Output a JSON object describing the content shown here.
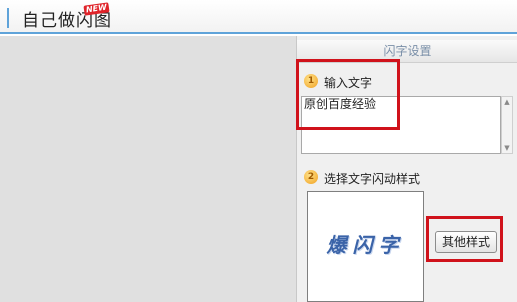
{
  "app": {
    "title": "自己做闪图",
    "new_badge": "NEW"
  },
  "panel": {
    "header": "闪字设置",
    "step1": {
      "number": "1",
      "label": "输入文字"
    },
    "text_value": "原创百度经验",
    "step2": {
      "number": "2",
      "label": "选择文字闪动样式"
    },
    "preview_text": "爆闪字",
    "other_styles_button": "其他样式"
  },
  "colors": {
    "accent": "#5fa3d9",
    "highlight": "#d0121b",
    "preview_text": "#3a63a8"
  }
}
